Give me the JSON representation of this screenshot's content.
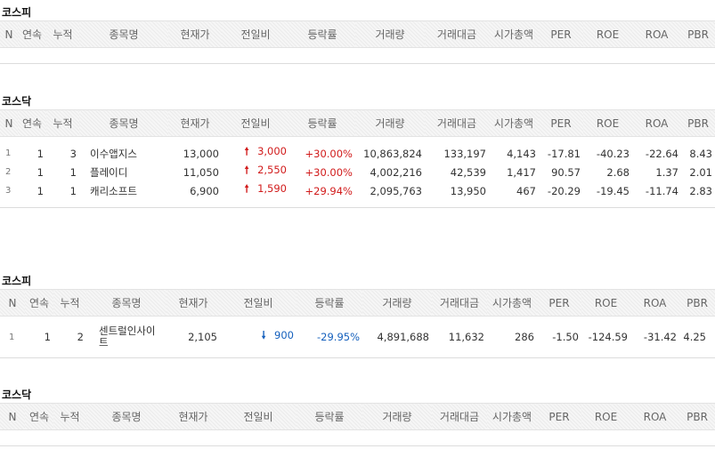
{
  "columns": [
    "N",
    "연속",
    "누적",
    "종목명",
    "현재가",
    "전일비",
    "등락률",
    "거래량",
    "거래대금",
    "시가총액",
    "PER",
    "ROE",
    "ROA",
    "PBR"
  ],
  "sections": [
    {
      "title": "코스피",
      "rows": []
    },
    {
      "title": "코스닥",
      "rows": [
        {
          "n": "1",
          "streak": "1",
          "total": "3",
          "name": "이수앱지스",
          "price": "13,000",
          "change_dir": "up",
          "change": "3,000",
          "rate": "+30.00%",
          "volume": "10,863,824",
          "amount": "133,197",
          "mktcap": "4,143",
          "per": "-17.81",
          "roe": "-40.23",
          "roa": "-22.64",
          "pbr": "8.43"
        },
        {
          "n": "2",
          "streak": "1",
          "total": "1",
          "name": "플레이디",
          "price": "11,050",
          "change_dir": "up",
          "change": "2,550",
          "rate": "+30.00%",
          "volume": "4,002,216",
          "amount": "42,539",
          "mktcap": "1,417",
          "per": "90.57",
          "roe": "2.68",
          "roa": "1.37",
          "pbr": "2.01"
        },
        {
          "n": "3",
          "streak": "1",
          "total": "1",
          "name": "캐리소프트",
          "price": "6,900",
          "change_dir": "up",
          "change": "1,590",
          "rate": "+29.94%",
          "volume": "2,095,763",
          "amount": "13,950",
          "mktcap": "467",
          "per": "-20.29",
          "roe": "-19.45",
          "roa": "-11.74",
          "pbr": "2.83"
        }
      ]
    },
    {
      "title": "코스피",
      "rows": [
        {
          "n": "1",
          "streak": "1",
          "total": "2",
          "name": "센트럴인사이트",
          "price": "2,105",
          "change_dir": "down",
          "change": "900",
          "rate": "-29.95%",
          "volume": "4,891,688",
          "amount": "11,632",
          "mktcap": "286",
          "per": "-1.50",
          "roe": "-124.59",
          "roa": "-31.42",
          "pbr": "4.25"
        }
      ]
    },
    {
      "title": "코스닥",
      "rows": []
    }
  ],
  "icons": {
    "up": "arrow-up-icon",
    "down": "arrow-down-icon"
  },
  "colors": {
    "up": "#d11b1b",
    "down": "#1560bd"
  }
}
